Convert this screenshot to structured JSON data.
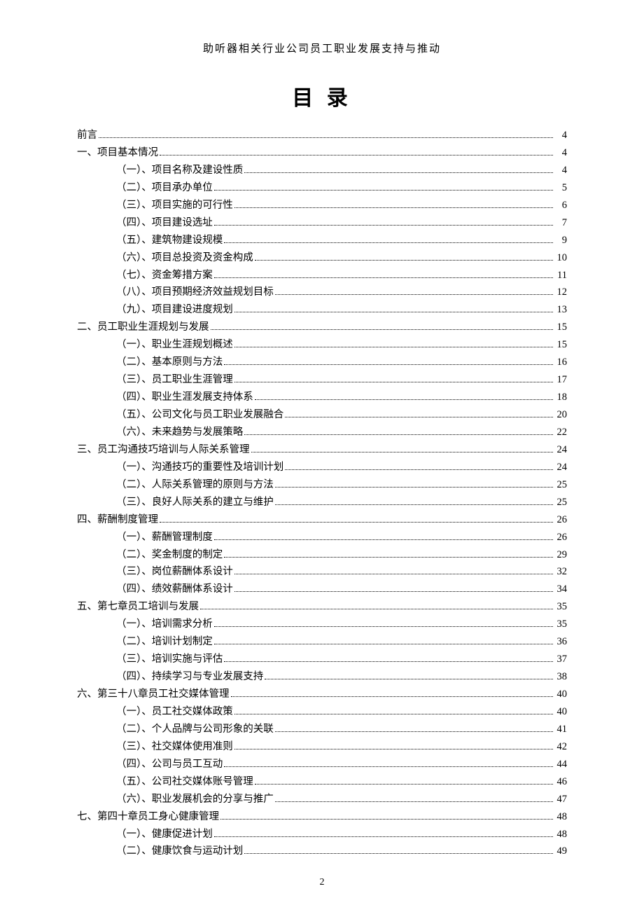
{
  "header": "助听器相关行业公司员工职业发展支持与推动",
  "title": "目 录",
  "footer_page": "2",
  "toc": [
    {
      "level": 1,
      "label": "前言",
      "page": "4"
    },
    {
      "level": 1,
      "label": "一、项目基本情况",
      "page": "4"
    },
    {
      "level": 2,
      "label": "（一）、项目名称及建设性质",
      "page": "4"
    },
    {
      "level": 2,
      "label": "（二）、项目承办单位",
      "page": "5"
    },
    {
      "level": 2,
      "label": "（三）、项目实施的可行性",
      "page": "6"
    },
    {
      "level": 2,
      "label": "（四）、项目建设选址",
      "page": "7"
    },
    {
      "level": 2,
      "label": "（五）、建筑物建设规模",
      "page": "9"
    },
    {
      "level": 2,
      "label": "（六）、项目总投资及资金构成",
      "page": "10"
    },
    {
      "level": 2,
      "label": "（七）、资金筹措方案",
      "page": "11"
    },
    {
      "level": 2,
      "label": "（八）、项目预期经济效益规划目标",
      "page": "12"
    },
    {
      "level": 2,
      "label": "（九）、项目建设进度规划",
      "page": "13"
    },
    {
      "level": 1,
      "label": "二、员工职业生涯规划与发展",
      "page": "15"
    },
    {
      "level": 2,
      "label": "（一）、职业生涯规划概述",
      "page": "15"
    },
    {
      "level": 2,
      "label": "（二）、基本原则与方法",
      "page": "16"
    },
    {
      "level": 2,
      "label": "（三）、员工职业生涯管理",
      "page": "17"
    },
    {
      "level": 2,
      "label": "（四）、职业生涯发展支持体系",
      "page": "18"
    },
    {
      "level": 2,
      "label": "（五）、公司文化与员工职业发展融合",
      "page": "20"
    },
    {
      "level": 2,
      "label": "（六）、未来趋势与发展策略",
      "page": "22"
    },
    {
      "level": 1,
      "label": "三、员工沟通技巧培训与人际关系管理",
      "page": "24"
    },
    {
      "level": 2,
      "label": "（一）、沟通技巧的重要性及培训计划",
      "page": "24"
    },
    {
      "level": 2,
      "label": "（二）、人际关系管理的原则与方法",
      "page": "25"
    },
    {
      "level": 2,
      "label": "（三）、良好人际关系的建立与维护",
      "page": "25"
    },
    {
      "level": 1,
      "label": "四、薪酬制度管理",
      "page": "26"
    },
    {
      "level": 2,
      "label": "（一）、薪酬管理制度",
      "page": "26"
    },
    {
      "level": 2,
      "label": "（二）、奖金制度的制定",
      "page": "29"
    },
    {
      "level": 2,
      "label": "（三）、岗位薪酬体系设计",
      "page": "32"
    },
    {
      "level": 2,
      "label": "（四）、绩效薪酬体系设计",
      "page": "34"
    },
    {
      "level": 1,
      "label": "五、第七章员工培训与发展",
      "page": "35"
    },
    {
      "level": 2,
      "label": "（一）、培训需求分析",
      "page": "35"
    },
    {
      "level": 2,
      "label": "（二）、培训计划制定",
      "page": "36"
    },
    {
      "level": 2,
      "label": "（三）、培训实施与评估",
      "page": "37"
    },
    {
      "level": 2,
      "label": "（四）、持续学习与专业发展支持",
      "page": "38"
    },
    {
      "level": 1,
      "label": "六、第三十八章员工社交媒体管理",
      "page": "40"
    },
    {
      "level": 2,
      "label": "（一）、员工社交媒体政策",
      "page": "40"
    },
    {
      "level": 2,
      "label": "（二）、个人品牌与公司形象的关联",
      "page": "41"
    },
    {
      "level": 2,
      "label": "（三）、社交媒体使用准则",
      "page": "42"
    },
    {
      "level": 2,
      "label": "（四）、公司与员工互动",
      "page": "44"
    },
    {
      "level": 2,
      "label": "（五）、公司社交媒体账号管理",
      "page": "46"
    },
    {
      "level": 2,
      "label": "（六）、职业发展机会的分享与推广",
      "page": "47"
    },
    {
      "level": 1,
      "label": "七、第四十章员工身心健康管理",
      "page": "48"
    },
    {
      "level": 2,
      "label": "（一）、健康促进计划",
      "page": "48"
    },
    {
      "level": 2,
      "label": "（二）、健康饮食与运动计划",
      "page": "49"
    }
  ]
}
